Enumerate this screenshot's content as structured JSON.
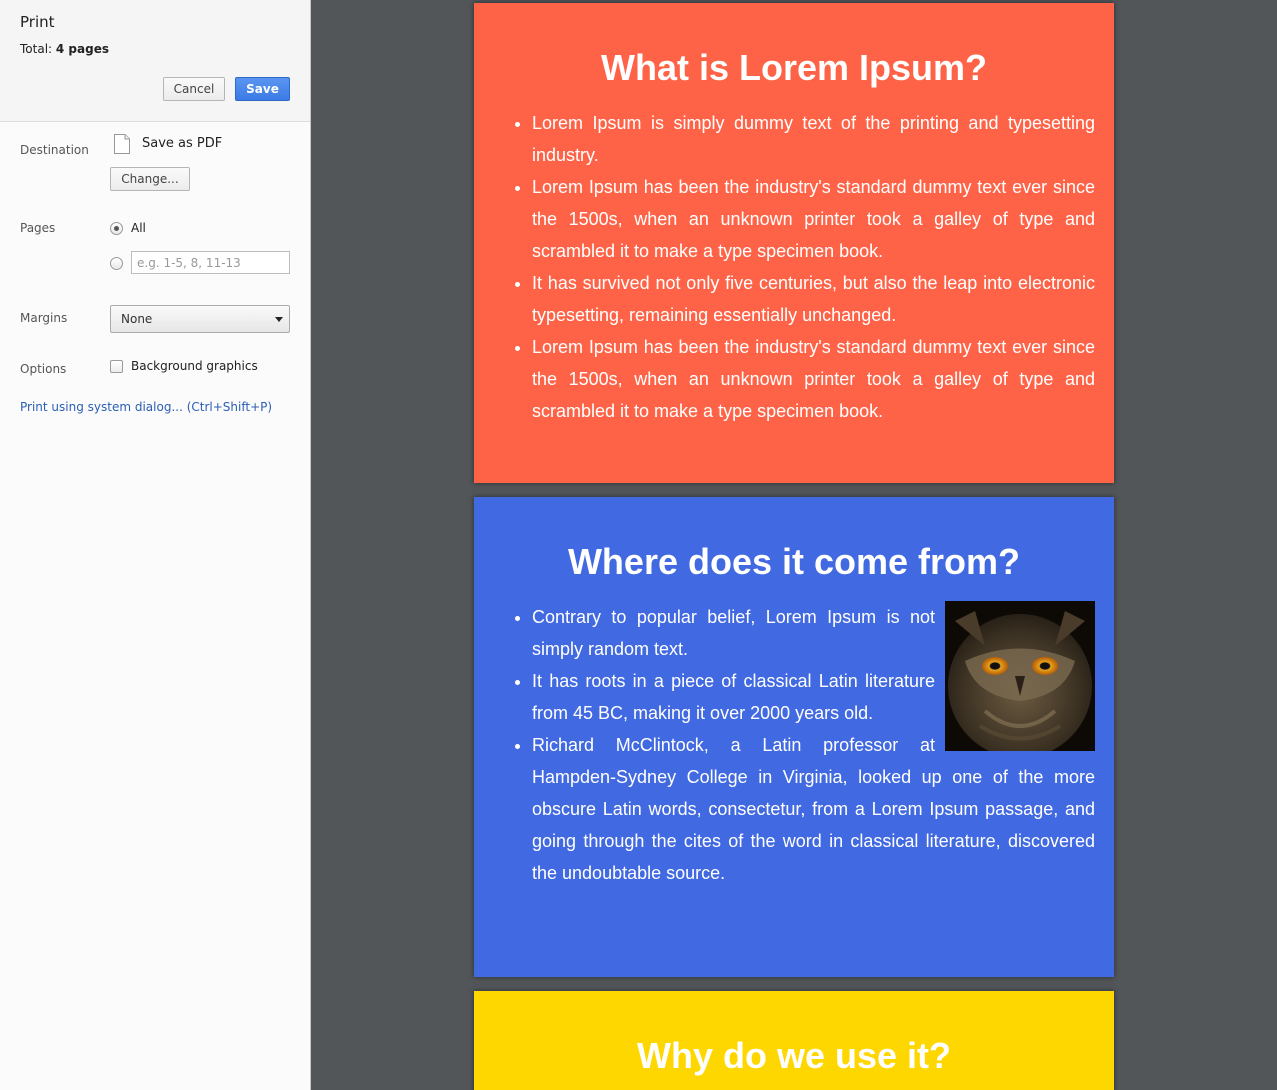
{
  "sidebar": {
    "title": "Print",
    "total_label": "Total:",
    "total_value": "4 pages",
    "cancel_label": "Cancel",
    "save_label": "Save",
    "destination": {
      "label": "Destination",
      "value": "Save as PDF",
      "change_label": "Change..."
    },
    "pages": {
      "label": "Pages",
      "all_label": "All",
      "selected": "All",
      "custom_placeholder": "e.g. 1-5, 8, 11-13"
    },
    "margins": {
      "label": "Margins",
      "value": "None"
    },
    "options": {
      "label": "Options",
      "background_graphics_label": "Background graphics",
      "background_graphics_checked": false
    },
    "system_dialog_link": "Print using system dialog... (Ctrl+Shift+P)"
  },
  "preview": {
    "pages": [
      {
        "color": "#ff6347",
        "heading": "What is Lorem Ipsum?",
        "items": [
          "Lorem Ipsum is simply dummy text of the printing and typesetting industry.",
          "Lorem Ipsum has been the industry's standard dummy text ever since the 1500s, when an unknown printer took a galley of type and scrambled it to make a type specimen book.",
          "It has survived not only five centuries, but also the leap into electronic typesetting, remaining essentially unchanged.",
          "Lorem Ipsum has been the industry's standard dummy text ever since the 1500s, when an unknown printer took a galley of type and scrambled it to make a type specimen book."
        ]
      },
      {
        "color": "#4169e1",
        "heading": "Where does it come from?",
        "image": "owl-photo",
        "items": [
          "Contrary to popular belief, Lorem Ipsum is not simply random text.",
          "It has roots in a piece of classical Latin literature from 45 BC, making it over 2000 years old.",
          "Richard McClintock, a Latin professor at Hampden-Sydney College in Virginia, looked up one of the more obscure Latin words, consectetur, from a Lorem Ipsum passage, and going through the cites of the word in classical literature, discovered the undoubtable source."
        ]
      },
      {
        "color": "#ffd700",
        "heading": "Why do we use it?"
      }
    ]
  }
}
